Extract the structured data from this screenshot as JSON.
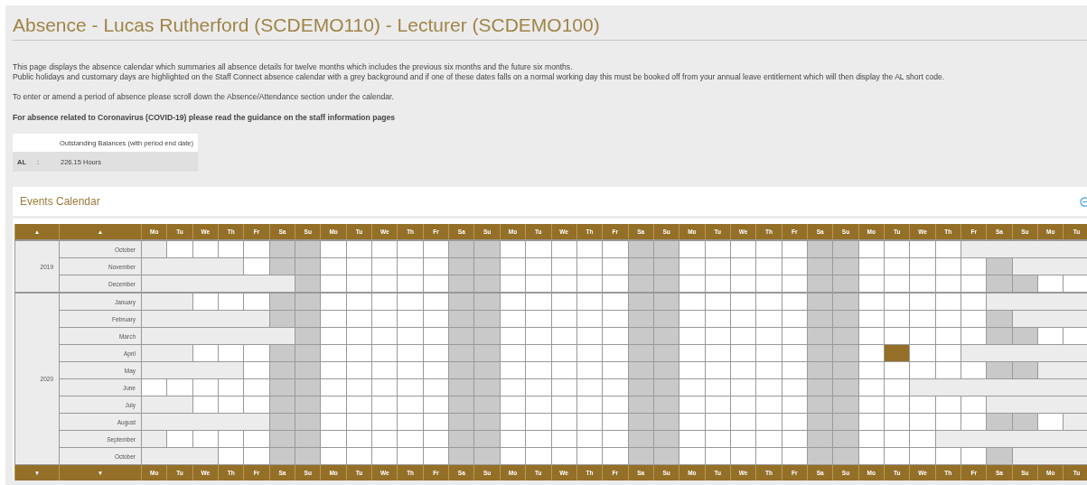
{
  "title": "Absence - Lucas Rutherford (SCDEMO110) - Lecturer (SCDEMO100)",
  "intro": [
    "This page displays the absence calendar which summaries all absence details for twelve months which includes the previous six months and the future six months.",
    "Public holidays and customary days are highlighted on the Staff Connect absence calendar with a grey background and if one of these dates falls on a normal working day this must be booked off from your annual leave entitlement which will then display the AL short code."
  ],
  "instruction": "To enter or amend a period of absence please scroll down the Absence/Attendance section under the calendar.",
  "notice": "For absence related to Coronavirus (COVID-19) please read the guidance on the staff information pages",
  "balances": {
    "heading": "Outstanding Balances (with period end date)",
    "rows": [
      {
        "code": "AL",
        "separator": ":",
        "value": "226.15 Hours"
      }
    ]
  },
  "calendar": {
    "title": "Events Calendar",
    "expanded": true,
    "header_arrows": [
      "▲",
      "▲"
    ],
    "days": [
      {
        "label": "Mo",
        "weekend": false
      },
      {
        "label": "Tu",
        "weekend": false
      },
      {
        "label": "We",
        "weekend": false
      },
      {
        "label": "Th",
        "weekend": false
      },
      {
        "label": "Fr",
        "weekend": false
      },
      {
        "label": "Sa",
        "weekend": true
      },
      {
        "label": "Su",
        "weekend": true
      },
      {
        "label": "Mo",
        "weekend": false
      },
      {
        "label": "Tu",
        "weekend": false
      },
      {
        "label": "We",
        "weekend": false
      },
      {
        "label": "Th",
        "weekend": false
      },
      {
        "label": "Fr",
        "weekend": false
      },
      {
        "label": "Sa",
        "weekend": true
      },
      {
        "label": "Su",
        "weekend": true
      },
      {
        "label": "Mo",
        "weekend": false
      },
      {
        "label": "Tu",
        "weekend": false
      },
      {
        "label": "We",
        "weekend": false
      },
      {
        "label": "Th",
        "weekend": false
      },
      {
        "label": "Fr",
        "weekend": false
      },
      {
        "label": "Sa",
        "weekend": true
      },
      {
        "label": "Su",
        "weekend": true
      },
      {
        "label": "Mo",
        "weekend": false
      },
      {
        "label": "Tu",
        "weekend": false
      },
      {
        "label": "We",
        "weekend": false
      },
      {
        "label": "Th",
        "weekend": false
      },
      {
        "label": "Fr",
        "weekend": false
      },
      {
        "label": "Sa",
        "weekend": true
      },
      {
        "label": "Su",
        "weekend": true
      },
      {
        "label": "Mo",
        "weekend": false
      },
      {
        "label": "Tu",
        "weekend": false
      },
      {
        "label": "We",
        "weekend": false
      },
      {
        "label": "Th",
        "weekend": false
      },
      {
        "label": "Fr",
        "weekend": false
      },
      {
        "label": "Sa",
        "weekend": true
      },
      {
        "label": "Su",
        "weekend": true
      },
      {
        "label": "Mo",
        "weekend": false
      },
      {
        "label": "Tu",
        "weekend": false
      }
    ],
    "years": [
      {
        "year": "2019",
        "months": [
          {
            "name": "October",
            "cells": [
              {
                "kind": "blank"
              },
              {
                "kind": "day"
              },
              {
                "kind": "day"
              },
              {
                "kind": "day"
              },
              {
                "kind": "day"
              },
              {
                "kind": "day"
              },
              {
                "kind": "day"
              },
              {
                "kind": "day"
              },
              {
                "kind": "day"
              },
              {
                "kind": "day"
              },
              {
                "kind": "day"
              },
              {
                "kind": "day"
              },
              {
                "kind": "day"
              },
              {
                "kind": "day"
              },
              {
                "kind": "day"
              },
              {
                "kind": "day"
              },
              {
                "kind": "day"
              },
              {
                "kind": "day"
              },
              {
                "kind": "day"
              },
              {
                "kind": "day"
              },
              {
                "kind": "day"
              },
              {
                "kind": "day"
              },
              {
                "kind": "day"
              },
              {
                "kind": "day"
              },
              {
                "kind": "day"
              },
              {
                "kind": "day"
              },
              {
                "kind": "day"
              },
              {
                "kind": "day"
              },
              {
                "kind": "day"
              },
              {
                "kind": "day"
              },
              {
                "kind": "day"
              },
              {
                "kind": "day"
              },
              {
                "kind": "blank"
              },
              {
                "kind": "blank"
              },
              {
                "kind": "blank"
              },
              {
                "kind": "blank"
              },
              {
                "kind": "blank"
              }
            ]
          },
          {
            "name": "November",
            "cells": [
              {
                "kind": "blank"
              },
              {
                "kind": "blank"
              },
              {
                "kind": "blank"
              },
              {
                "kind": "blank"
              },
              {
                "kind": "day"
              },
              {
                "kind": "day"
              },
              {
                "kind": "day"
              },
              {
                "kind": "day"
              },
              {
                "kind": "day"
              },
              {
                "kind": "day"
              },
              {
                "kind": "day"
              },
              {
                "kind": "day"
              },
              {
                "kind": "day"
              },
              {
                "kind": "day"
              },
              {
                "kind": "day"
              },
              {
                "kind": "day"
              },
              {
                "kind": "day"
              },
              {
                "kind": "day"
              },
              {
                "kind": "day"
              },
              {
                "kind": "day"
              },
              {
                "kind": "day"
              },
              {
                "kind": "day"
              },
              {
                "kind": "day"
              },
              {
                "kind": "day"
              },
              {
                "kind": "day"
              },
              {
                "kind": "day"
              },
              {
                "kind": "day"
              },
              {
                "kind": "day"
              },
              {
                "kind": "day"
              },
              {
                "kind": "day"
              },
              {
                "kind": "day"
              },
              {
                "kind": "day"
              },
              {
                "kind": "day"
              },
              {
                "kind": "day"
              },
              {
                "kind": "blank"
              },
              {
                "kind": "blank"
              },
              {
                "kind": "blank"
              }
            ]
          },
          {
            "name": "December",
            "cells": [
              {
                "kind": "blank"
              },
              {
                "kind": "blank"
              },
              {
                "kind": "blank"
              },
              {
                "kind": "blank"
              },
              {
                "kind": "blank"
              },
              {
                "kind": "blank"
              },
              {
                "kind": "day"
              },
              {
                "kind": "day"
              },
              {
                "kind": "day"
              },
              {
                "kind": "day"
              },
              {
                "kind": "day"
              },
              {
                "kind": "day"
              },
              {
                "kind": "day"
              },
              {
                "kind": "day"
              },
              {
                "kind": "day"
              },
              {
                "kind": "day"
              },
              {
                "kind": "day"
              },
              {
                "kind": "day"
              },
              {
                "kind": "day"
              },
              {
                "kind": "day"
              },
              {
                "kind": "day"
              },
              {
                "kind": "day"
              },
              {
                "kind": "day"
              },
              {
                "kind": "day"
              },
              {
                "kind": "day"
              },
              {
                "kind": "day"
              },
              {
                "kind": "day"
              },
              {
                "kind": "day"
              },
              {
                "kind": "day"
              },
              {
                "kind": "day"
              },
              {
                "kind": "day"
              },
              {
                "kind": "day"
              },
              {
                "kind": "day"
              },
              {
                "kind": "day"
              },
              {
                "kind": "day"
              },
              {
                "kind": "day"
              },
              {
                "kind": "day"
              }
            ]
          }
        ]
      },
      {
        "year": "2020",
        "months": [
          {
            "name": "January",
            "cells": [
              {
                "kind": "blank"
              },
              {
                "kind": "blank"
              },
              {
                "kind": "day"
              },
              {
                "kind": "day"
              },
              {
                "kind": "day"
              },
              {
                "kind": "day"
              },
              {
                "kind": "day"
              },
              {
                "kind": "day"
              },
              {
                "kind": "day"
              },
              {
                "kind": "day"
              },
              {
                "kind": "day"
              },
              {
                "kind": "day"
              },
              {
                "kind": "day"
              },
              {
                "kind": "day"
              },
              {
                "kind": "day"
              },
              {
                "kind": "day"
              },
              {
                "kind": "day"
              },
              {
                "kind": "day"
              },
              {
                "kind": "day"
              },
              {
                "kind": "day"
              },
              {
                "kind": "day"
              },
              {
                "kind": "day"
              },
              {
                "kind": "day"
              },
              {
                "kind": "day"
              },
              {
                "kind": "day"
              },
              {
                "kind": "day"
              },
              {
                "kind": "day"
              },
              {
                "kind": "day"
              },
              {
                "kind": "day"
              },
              {
                "kind": "day"
              },
              {
                "kind": "day"
              },
              {
                "kind": "day"
              },
              {
                "kind": "day"
              },
              {
                "kind": "blank"
              },
              {
                "kind": "blank"
              },
              {
                "kind": "blank"
              },
              {
                "kind": "blank"
              }
            ]
          },
          {
            "name": "February",
            "cells": [
              {
                "kind": "blank"
              },
              {
                "kind": "blank"
              },
              {
                "kind": "blank"
              },
              {
                "kind": "blank"
              },
              {
                "kind": "blank"
              },
              {
                "kind": "day"
              },
              {
                "kind": "day"
              },
              {
                "kind": "day"
              },
              {
                "kind": "day"
              },
              {
                "kind": "day"
              },
              {
                "kind": "day"
              },
              {
                "kind": "day"
              },
              {
                "kind": "day"
              },
              {
                "kind": "day"
              },
              {
                "kind": "day"
              },
              {
                "kind": "day"
              },
              {
                "kind": "day"
              },
              {
                "kind": "day"
              },
              {
                "kind": "day"
              },
              {
                "kind": "day"
              },
              {
                "kind": "day"
              },
              {
                "kind": "day"
              },
              {
                "kind": "day"
              },
              {
                "kind": "day"
              },
              {
                "kind": "day"
              },
              {
                "kind": "day"
              },
              {
                "kind": "day"
              },
              {
                "kind": "day"
              },
              {
                "kind": "day"
              },
              {
                "kind": "day"
              },
              {
                "kind": "day"
              },
              {
                "kind": "day"
              },
              {
                "kind": "day"
              },
              {
                "kind": "day"
              },
              {
                "kind": "blank"
              },
              {
                "kind": "blank"
              },
              {
                "kind": "blank"
              }
            ]
          },
          {
            "name": "March",
            "cells": [
              {
                "kind": "blank"
              },
              {
                "kind": "blank"
              },
              {
                "kind": "blank"
              },
              {
                "kind": "blank"
              },
              {
                "kind": "blank"
              },
              {
                "kind": "blank"
              },
              {
                "kind": "day"
              },
              {
                "kind": "day"
              },
              {
                "kind": "day"
              },
              {
                "kind": "day"
              },
              {
                "kind": "day"
              },
              {
                "kind": "day"
              },
              {
                "kind": "day"
              },
              {
                "kind": "day"
              },
              {
                "kind": "day"
              },
              {
                "kind": "day"
              },
              {
                "kind": "day"
              },
              {
                "kind": "day"
              },
              {
                "kind": "day"
              },
              {
                "kind": "day"
              },
              {
                "kind": "day"
              },
              {
                "kind": "day"
              },
              {
                "kind": "day"
              },
              {
                "kind": "day"
              },
              {
                "kind": "day"
              },
              {
                "kind": "day"
              },
              {
                "kind": "day"
              },
              {
                "kind": "day"
              },
              {
                "kind": "day"
              },
              {
                "kind": "day"
              },
              {
                "kind": "day"
              },
              {
                "kind": "day"
              },
              {
                "kind": "day"
              },
              {
                "kind": "day"
              },
              {
                "kind": "day"
              },
              {
                "kind": "day"
              },
              {
                "kind": "day"
              }
            ]
          },
          {
            "name": "April",
            "cells": [
              {
                "kind": "blank"
              },
              {
                "kind": "blank"
              },
              {
                "kind": "day"
              },
              {
                "kind": "day"
              },
              {
                "kind": "day"
              },
              {
                "kind": "day"
              },
              {
                "kind": "day"
              },
              {
                "kind": "day"
              },
              {
                "kind": "day"
              },
              {
                "kind": "day"
              },
              {
                "kind": "day"
              },
              {
                "kind": "day"
              },
              {
                "kind": "day"
              },
              {
                "kind": "day"
              },
              {
                "kind": "day"
              },
              {
                "kind": "day"
              },
              {
                "kind": "day"
              },
              {
                "kind": "day"
              },
              {
                "kind": "day"
              },
              {
                "kind": "day"
              },
              {
                "kind": "day"
              },
              {
                "kind": "day"
              },
              {
                "kind": "day"
              },
              {
                "kind": "day"
              },
              {
                "kind": "day"
              },
              {
                "kind": "day"
              },
              {
                "kind": "day"
              },
              {
                "kind": "day"
              },
              {
                "kind": "day"
              },
              {
                "kind": "absence"
              },
              {
                "kind": "day"
              },
              {
                "kind": "day"
              },
              {
                "kind": "blank"
              },
              {
                "kind": "blank"
              },
              {
                "kind": "blank"
              },
              {
                "kind": "blank"
              },
              {
                "kind": "blank"
              }
            ]
          },
          {
            "name": "May",
            "cells": [
              {
                "kind": "blank"
              },
              {
                "kind": "blank"
              },
              {
                "kind": "blank"
              },
              {
                "kind": "blank"
              },
              {
                "kind": "day"
              },
              {
                "kind": "day"
              },
              {
                "kind": "day"
              },
              {
                "kind": "day"
              },
              {
                "kind": "day"
              },
              {
                "kind": "day"
              },
              {
                "kind": "day"
              },
              {
                "kind": "day"
              },
              {
                "kind": "day"
              },
              {
                "kind": "day"
              },
              {
                "kind": "day"
              },
              {
                "kind": "day"
              },
              {
                "kind": "day"
              },
              {
                "kind": "day"
              },
              {
                "kind": "day"
              },
              {
                "kind": "day"
              },
              {
                "kind": "day"
              },
              {
                "kind": "day"
              },
              {
                "kind": "day"
              },
              {
                "kind": "day"
              },
              {
                "kind": "day"
              },
              {
                "kind": "day"
              },
              {
                "kind": "day"
              },
              {
                "kind": "day"
              },
              {
                "kind": "day"
              },
              {
                "kind": "day"
              },
              {
                "kind": "day"
              },
              {
                "kind": "day"
              },
              {
                "kind": "day"
              },
              {
                "kind": "day"
              },
              {
                "kind": "day"
              },
              {
                "kind": "blank"
              },
              {
                "kind": "blank"
              }
            ]
          },
          {
            "name": "June",
            "cells": [
              {
                "kind": "day"
              },
              {
                "kind": "day"
              },
              {
                "kind": "day"
              },
              {
                "kind": "day"
              },
              {
                "kind": "day"
              },
              {
                "kind": "day"
              },
              {
                "kind": "day"
              },
              {
                "kind": "day"
              },
              {
                "kind": "day"
              },
              {
                "kind": "day"
              },
              {
                "kind": "day"
              },
              {
                "kind": "day"
              },
              {
                "kind": "day"
              },
              {
                "kind": "day"
              },
              {
                "kind": "day"
              },
              {
                "kind": "day"
              },
              {
                "kind": "day"
              },
              {
                "kind": "day"
              },
              {
                "kind": "day"
              },
              {
                "kind": "day"
              },
              {
                "kind": "day"
              },
              {
                "kind": "day"
              },
              {
                "kind": "day"
              },
              {
                "kind": "day"
              },
              {
                "kind": "day"
              },
              {
                "kind": "day"
              },
              {
                "kind": "day"
              },
              {
                "kind": "day"
              },
              {
                "kind": "day"
              },
              {
                "kind": "day"
              },
              {
                "kind": "blank"
              },
              {
                "kind": "blank"
              },
              {
                "kind": "blank"
              },
              {
                "kind": "blank"
              },
              {
                "kind": "blank"
              },
              {
                "kind": "blank"
              },
              {
                "kind": "blank"
              }
            ]
          },
          {
            "name": "July",
            "cells": [
              {
                "kind": "blank"
              },
              {
                "kind": "blank"
              },
              {
                "kind": "day"
              },
              {
                "kind": "day"
              },
              {
                "kind": "day"
              },
              {
                "kind": "day"
              },
              {
                "kind": "day"
              },
              {
                "kind": "day"
              },
              {
                "kind": "day"
              },
              {
                "kind": "day"
              },
              {
                "kind": "day"
              },
              {
                "kind": "day"
              },
              {
                "kind": "day"
              },
              {
                "kind": "day"
              },
              {
                "kind": "day"
              },
              {
                "kind": "day"
              },
              {
                "kind": "day"
              },
              {
                "kind": "day"
              },
              {
                "kind": "day"
              },
              {
                "kind": "day"
              },
              {
                "kind": "day"
              },
              {
                "kind": "day"
              },
              {
                "kind": "day"
              },
              {
                "kind": "day"
              },
              {
                "kind": "day"
              },
              {
                "kind": "day"
              },
              {
                "kind": "day"
              },
              {
                "kind": "day"
              },
              {
                "kind": "day"
              },
              {
                "kind": "day"
              },
              {
                "kind": "day"
              },
              {
                "kind": "day"
              },
              {
                "kind": "day"
              },
              {
                "kind": "blank"
              },
              {
                "kind": "blank"
              },
              {
                "kind": "blank"
              },
              {
                "kind": "blank"
              }
            ]
          },
          {
            "name": "August",
            "cells": [
              {
                "kind": "blank"
              },
              {
                "kind": "blank"
              },
              {
                "kind": "blank"
              },
              {
                "kind": "blank"
              },
              {
                "kind": "blank"
              },
              {
                "kind": "day"
              },
              {
                "kind": "day"
              },
              {
                "kind": "day"
              },
              {
                "kind": "day"
              },
              {
                "kind": "day"
              },
              {
                "kind": "day"
              },
              {
                "kind": "day"
              },
              {
                "kind": "day"
              },
              {
                "kind": "day"
              },
              {
                "kind": "day"
              },
              {
                "kind": "day"
              },
              {
                "kind": "day"
              },
              {
                "kind": "day"
              },
              {
                "kind": "day"
              },
              {
                "kind": "day"
              },
              {
                "kind": "day"
              },
              {
                "kind": "day"
              },
              {
                "kind": "day"
              },
              {
                "kind": "day"
              },
              {
                "kind": "day"
              },
              {
                "kind": "day"
              },
              {
                "kind": "day"
              },
              {
                "kind": "day"
              },
              {
                "kind": "day"
              },
              {
                "kind": "day"
              },
              {
                "kind": "day"
              },
              {
                "kind": "day"
              },
              {
                "kind": "day"
              },
              {
                "kind": "day"
              },
              {
                "kind": "day"
              },
              {
                "kind": "day"
              },
              {
                "kind": "blank"
              }
            ]
          },
          {
            "name": "September",
            "cells": [
              {
                "kind": "blank"
              },
              {
                "kind": "day"
              },
              {
                "kind": "day"
              },
              {
                "kind": "day"
              },
              {
                "kind": "day"
              },
              {
                "kind": "day"
              },
              {
                "kind": "day"
              },
              {
                "kind": "day"
              },
              {
                "kind": "day"
              },
              {
                "kind": "day"
              },
              {
                "kind": "day"
              },
              {
                "kind": "day"
              },
              {
                "kind": "day"
              },
              {
                "kind": "day"
              },
              {
                "kind": "day"
              },
              {
                "kind": "day"
              },
              {
                "kind": "day"
              },
              {
                "kind": "day"
              },
              {
                "kind": "day"
              },
              {
                "kind": "day"
              },
              {
                "kind": "day"
              },
              {
                "kind": "day"
              },
              {
                "kind": "day"
              },
              {
                "kind": "day"
              },
              {
                "kind": "day"
              },
              {
                "kind": "day"
              },
              {
                "kind": "day"
              },
              {
                "kind": "day"
              },
              {
                "kind": "day"
              },
              {
                "kind": "day"
              },
              {
                "kind": "day"
              },
              {
                "kind": "blank"
              },
              {
                "kind": "blank"
              },
              {
                "kind": "blank"
              },
              {
                "kind": "blank"
              },
              {
                "kind": "blank"
              },
              {
                "kind": "blank"
              }
            ]
          },
          {
            "name": "October",
            "cells": [
              {
                "kind": "blank"
              },
              {
                "kind": "blank"
              },
              {
                "kind": "blank"
              },
              {
                "kind": "day"
              },
              {
                "kind": "day"
              },
              {
                "kind": "day"
              },
              {
                "kind": "day"
              },
              {
                "kind": "day"
              },
              {
                "kind": "day"
              },
              {
                "kind": "day"
              },
              {
                "kind": "day"
              },
              {
                "kind": "day"
              },
              {
                "kind": "day"
              },
              {
                "kind": "day"
              },
              {
                "kind": "day"
              },
              {
                "kind": "day"
              },
              {
                "kind": "day"
              },
              {
                "kind": "day"
              },
              {
                "kind": "day"
              },
              {
                "kind": "day"
              },
              {
                "kind": "day"
              },
              {
                "kind": "day"
              },
              {
                "kind": "day"
              },
              {
                "kind": "day"
              },
              {
                "kind": "day"
              },
              {
                "kind": "day"
              },
              {
                "kind": "day"
              },
              {
                "kind": "day"
              },
              {
                "kind": "day"
              },
              {
                "kind": "day"
              },
              {
                "kind": "day"
              },
              {
                "kind": "day"
              },
              {
                "kind": "day"
              },
              {
                "kind": "day"
              },
              {
                "kind": "blank"
              },
              {
                "kind": "blank"
              },
              {
                "kind": "blank"
              }
            ]
          }
        ]
      }
    ],
    "footer_arrows": [
      "▼",
      "▼"
    ],
    "footer_days": [
      "Mo",
      "Tu",
      "We",
      "Th",
      "Fr",
      "Sa",
      "Su",
      "Mo",
      "Tu",
      "We",
      "Th",
      "Fr",
      "Sa",
      "Su",
      "Mo",
      "Tu",
      "We",
      "Th",
      "Fr",
      "Sa",
      "Su",
      "Mo",
      "Tu",
      "We",
      "Th",
      "Fr",
      "Sa",
      "Su",
      "Mo",
      "Tu",
      "We",
      "Th",
      "Fr",
      "Sa",
      "Su",
      "Mo",
      "Tu"
    ]
  }
}
